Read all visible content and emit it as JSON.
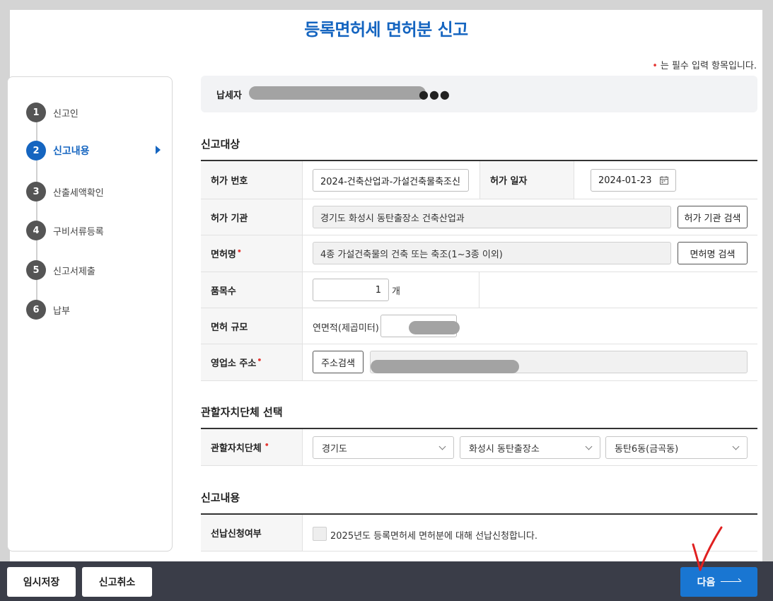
{
  "title": "등록면허세 면허분 신고",
  "required_note": "는 필수 입력 항목입니다.",
  "required_mark": "•",
  "steps": [
    {
      "num": "1",
      "label": "신고인"
    },
    {
      "num": "2",
      "label": "신고내용"
    },
    {
      "num": "3",
      "label": "산출세액확인"
    },
    {
      "num": "4",
      "label": "구비서류등록"
    },
    {
      "num": "5",
      "label": "신고서제출"
    },
    {
      "num": "6",
      "label": "납부"
    }
  ],
  "taxpayer": {
    "label": "납세자",
    "masked_suffix": "●●●"
  },
  "target": {
    "section_title": "신고대상",
    "permit_number_label": "허가 번호",
    "permit_number_value": "2024-건축산업과-가설건축물축조신",
    "permit_date_label": "허가 일자",
    "permit_date_value": "2024-01-23",
    "agency_label": "허가 기관",
    "agency_value": "경기도 화성시 동탄출장소 건축산업과",
    "agency_search": "허가 기관 검색",
    "license_name_label": "면허명",
    "license_name_value": "4종 가설건축물의 건축 또는 축조(1~3종 이외)",
    "license_search": "면허명 검색",
    "item_count_label": "품목수",
    "item_count_value": "1",
    "item_count_unit": "개",
    "scale_label": "면허 규모",
    "scale_sub_label": "연면적(제곱미터)",
    "address_label": "영업소 주소",
    "address_search": "주소검색"
  },
  "jurisdiction": {
    "section_title": "관할자치단체 선택",
    "label": "관할자치단체",
    "province": "경기도",
    "city": "화성시 동탄출장소",
    "district": "동탄6동(금곡동)"
  },
  "content": {
    "section_title": "신고내용",
    "prepay_label": "선납신청여부",
    "prepay_text": "2025년도 등록면허세 면허분에 대해 선납신청합니다."
  },
  "footer": {
    "temp_save": "임시저장",
    "cancel": "신고취소",
    "next": "다음"
  },
  "colors": {
    "accent": "#1565c0",
    "required": "#e53935",
    "footer_bg": "#3a3d48",
    "annotation": "#e02020"
  }
}
